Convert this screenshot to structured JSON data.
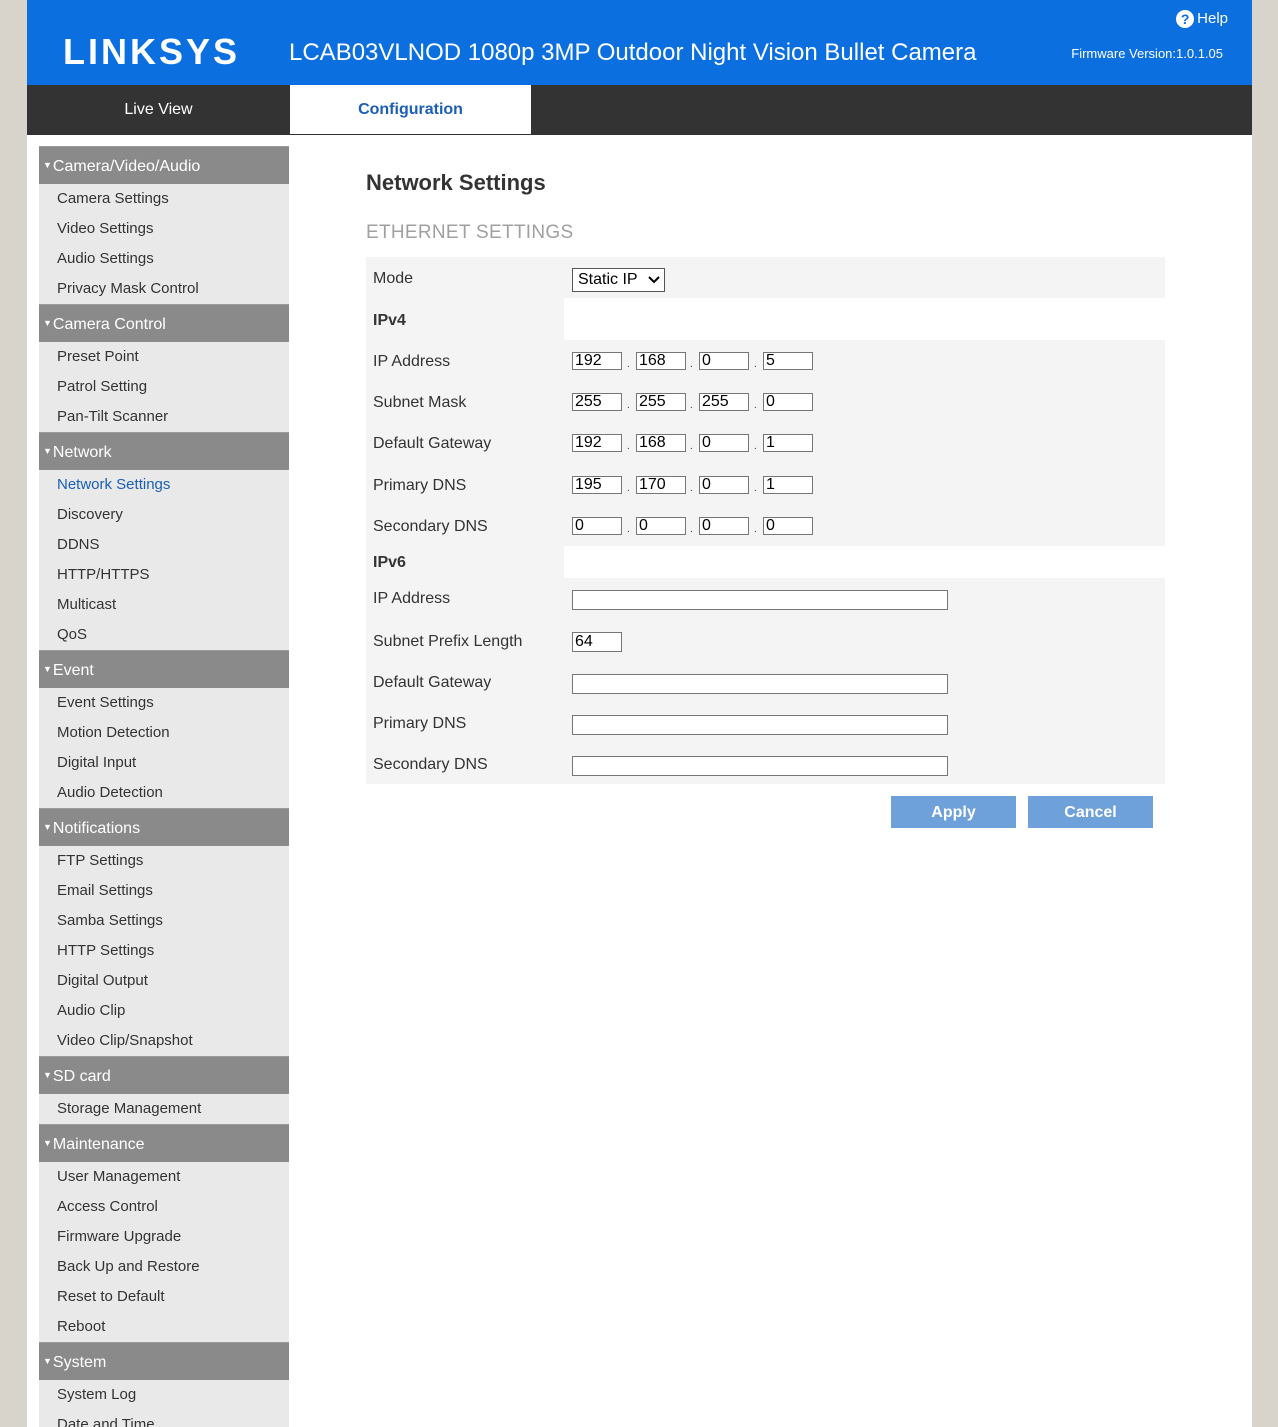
{
  "header": {
    "logo": "LINKSYS",
    "title": "LCAB03VLNOD 1080p 3MP Outdoor Night Vision Bullet Camera",
    "help": "Help",
    "firmware": "Firmware Version:1.0.1.05"
  },
  "tabs": {
    "live": "Live View",
    "config": "Configuration"
  },
  "sidebar": [
    {
      "title": "Camera/Video/Audio",
      "items": [
        "Camera Settings",
        "Video Settings",
        "Audio Settings",
        "Privacy Mask Control"
      ]
    },
    {
      "title": "Camera Control",
      "items": [
        "Preset Point",
        "Patrol Setting",
        "Pan-Tilt Scanner"
      ]
    },
    {
      "title": "Network",
      "items": [
        "Network Settings",
        "Discovery",
        "DDNS",
        "HTTP/HTTPS",
        "Multicast",
        "QoS"
      ]
    },
    {
      "title": "Event",
      "items": [
        "Event Settings",
        "Motion Detection",
        "Digital Input",
        "Audio Detection"
      ]
    },
    {
      "title": "Notifications",
      "items": [
        "FTP Settings",
        "Email Settings",
        "Samba Settings",
        "HTTP Settings",
        "Digital Output",
        "Audio Clip",
        "Video Clip/Snapshot"
      ]
    },
    {
      "title": "SD card",
      "items": [
        "Storage Management"
      ]
    },
    {
      "title": "Maintenance",
      "items": [
        "User Management",
        "Access Control",
        "Firmware Upgrade",
        "Back Up and Restore",
        "Reset to Default",
        "Reboot"
      ]
    },
    {
      "title": "System",
      "items": [
        "System Log",
        "Date and Time"
      ]
    }
  ],
  "active_item": "Network Settings",
  "main": {
    "title": "Network Settings",
    "subtitle": "ETHERNET SETTINGS",
    "mode_label": "Mode",
    "mode_value": "Static IP",
    "ipv4_label": "IPv4",
    "ipv4": {
      "ip_address_label": "IP Address",
      "ip_address": [
        "192",
        "168",
        "0",
        "5"
      ],
      "subnet_mask_label": "Subnet Mask",
      "subnet_mask": [
        "255",
        "255",
        "255",
        "0"
      ],
      "default_gateway_label": "Default Gateway",
      "default_gateway": [
        "192",
        "168",
        "0",
        "1"
      ],
      "primary_dns_label": "Primary DNS",
      "primary_dns": [
        "195",
        "170",
        "0",
        "1"
      ],
      "secondary_dns_label": "Secondary DNS",
      "secondary_dns": [
        "0",
        "0",
        "0",
        "0"
      ]
    },
    "ipv6_label": "IPv6",
    "ipv6": {
      "ip_address_label": "IP Address",
      "ip_address": "",
      "prefix_label": "Subnet Prefix Length",
      "prefix": "64",
      "default_gateway_label": "Default Gateway",
      "default_gateway": "",
      "primary_dns_label": "Primary DNS",
      "primary_dns": "",
      "secondary_dns_label": "Secondary DNS",
      "secondary_dns": ""
    },
    "apply_label": "Apply",
    "cancel_label": "Cancel"
  }
}
